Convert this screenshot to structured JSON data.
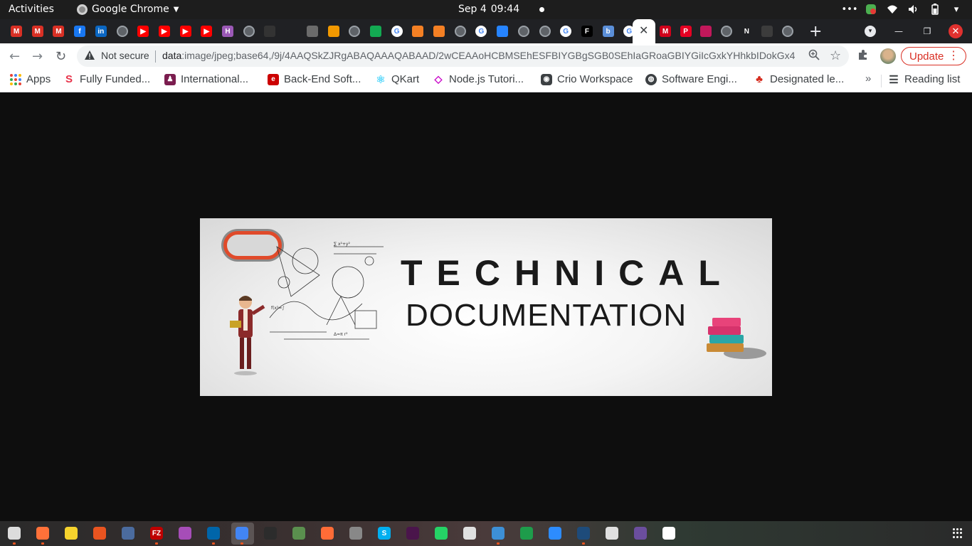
{
  "topbar": {
    "activities": "Activities",
    "app_name": "Google Chrome",
    "date": "Sep 4",
    "time": "09:44"
  },
  "tabs": {
    "favicons": [
      {
        "icon": "gmail-icon",
        "label": "M",
        "color": "#d93025"
      },
      {
        "icon": "gmail-icon",
        "label": "M",
        "color": "#d93025"
      },
      {
        "icon": "gmail-icon",
        "label": "M",
        "color": "#d93025"
      },
      {
        "icon": "facebook-icon",
        "label": "f",
        "color": "#1877f2"
      },
      {
        "icon": "linkedin-icon",
        "label": "in",
        "color": "#0a66c2"
      },
      {
        "icon": "globe-icon",
        "label": "",
        "color": "#5f6368"
      },
      {
        "icon": "youtube-icon",
        "label": "▶",
        "color": "#ff0000"
      },
      {
        "icon": "youtube-icon",
        "label": "▶",
        "color": "#ff0000"
      },
      {
        "icon": "youtube-icon",
        "label": "▶",
        "color": "#ff0000"
      },
      {
        "icon": "youtube-icon",
        "label": "▶",
        "color": "#ff0000"
      },
      {
        "icon": "hackerearth-icon",
        "label": "H",
        "color": "#9b59b6"
      },
      {
        "icon": "globe-icon",
        "label": "",
        "color": "#5f6368"
      },
      {
        "icon": "github-icon",
        "label": "",
        "color": "#333333"
      },
      {
        "icon": "bow-icon",
        "label": "",
        "color": "#202124"
      },
      {
        "icon": "app-icon",
        "label": "",
        "color": "#6b6b6b"
      },
      {
        "icon": "warning-app-icon",
        "label": "",
        "color": "#f29900"
      },
      {
        "icon": "globe-icon",
        "label": "",
        "color": "#5f6368"
      },
      {
        "icon": "mongodb-icon",
        "label": "",
        "color": "#13aa52"
      },
      {
        "icon": "google-icon",
        "label": "G",
        "color": "#ffffff"
      },
      {
        "icon": "stackoverflow-icon",
        "label": "",
        "color": "#f48024"
      },
      {
        "icon": "stackoverflow-icon",
        "label": "",
        "color": "#f48024"
      },
      {
        "icon": "globe-icon",
        "label": "",
        "color": "#5f6368"
      },
      {
        "icon": "google-icon",
        "label": "G",
        "color": "#ffffff"
      },
      {
        "icon": "atlassian-icon",
        "label": "",
        "color": "#2684ff"
      },
      {
        "icon": "globe-icon",
        "label": "",
        "color": "#5f6368"
      },
      {
        "icon": "globe-icon",
        "label": "",
        "color": "#5f6368"
      },
      {
        "icon": "google-icon",
        "label": "G",
        "color": "#ffffff"
      },
      {
        "icon": "f-icon",
        "label": "F",
        "color": "#000000"
      },
      {
        "icon": "bing-icon",
        "label": "b",
        "color": "#5b8fd9"
      },
      {
        "icon": "google-icon",
        "label": "G",
        "color": "#ffffff"
      }
    ],
    "favicons_right": [
      {
        "icon": "m-icon",
        "label": "M",
        "color": "#d0021b"
      },
      {
        "icon": "pinterest-icon",
        "label": "P",
        "color": "#e60023"
      },
      {
        "icon": "app-icon",
        "label": "",
        "color": "#c2185b"
      },
      {
        "icon": "globe-icon",
        "label": "",
        "color": "#5f6368"
      },
      {
        "icon": "notion-icon",
        "label": "N",
        "color": "#202124"
      },
      {
        "icon": "app-icon",
        "label": "",
        "color": "#3c3c3c"
      },
      {
        "icon": "globe-icon",
        "label": "",
        "color": "#5f6368"
      }
    ],
    "new_tab": "+"
  },
  "toolbar": {
    "security_label": "Not secure",
    "url_scheme": "data",
    "url_rest": ":image/jpeg;base64,/9j/4AAQSkZJRgABAQAAAQABAAD/2wCEAAoHCBMSEhESFBIYGBgSGB0SEhIaGRoaGBIYGiIcGxkYHhkbIDokGx4rH...",
    "update_label": "Update"
  },
  "bookmarks": [
    {
      "icon": "apps-icon",
      "label": "Apps"
    },
    {
      "icon": "fully-funded-icon",
      "label": "Fully Funded...",
      "color": "#e8334a"
    },
    {
      "icon": "international-icon",
      "label": "International...",
      "color": "#7b1d4f"
    },
    {
      "icon": "backend-icon",
      "label": "Back-End Soft...",
      "color": "#cc0000"
    },
    {
      "icon": "react-icon",
      "label": "QKart",
      "color": "#61dafb"
    },
    {
      "icon": "code-icon",
      "label": "Node.js Tutori...",
      "color": "#c800c8"
    },
    {
      "icon": "crio-icon",
      "label": "Crio Workspace",
      "color": "#3c4043"
    },
    {
      "icon": "globe-icon",
      "label": "Software Engi...",
      "color": "#3c4043"
    },
    {
      "icon": "maple-leaf-icon",
      "label": "Designated le...",
      "color": "#d52b1e"
    }
  ],
  "bookmarks_more": "»",
  "reading_list": "Reading list",
  "banner": {
    "title_line1": "TECHNICAL",
    "title_line2": "DOCUMENTATION"
  },
  "dock": [
    {
      "icon": "files-icon",
      "label": "",
      "color": "#dcdcdc"
    },
    {
      "icon": "firefox-icon",
      "label": "",
      "color": "#ff7139"
    },
    {
      "icon": "camera-app-icon",
      "label": "",
      "color": "#f6d32d"
    },
    {
      "icon": "software-center-icon",
      "label": "",
      "color": "#e95420"
    },
    {
      "icon": "eclipse-icon",
      "label": "",
      "color": "#4b6b9e"
    },
    {
      "icon": "filezilla-icon",
      "label": "FZ",
      "color": "#bf0000"
    },
    {
      "icon": "video-player-icon",
      "label": "",
      "color": "#a64db8"
    },
    {
      "icon": "vscode-icon",
      "label": "",
      "color": "#0065a9"
    },
    {
      "icon": "chrome-icon",
      "label": "",
      "color": "#4285f4"
    },
    {
      "icon": "terminal-icon",
      "label": "",
      "color": "#2c2c2c"
    },
    {
      "icon": "image-viewer-icon",
      "label": "",
      "color": "#5a8f4e"
    },
    {
      "icon": "postman-icon",
      "label": "",
      "color": "#ff6c37"
    },
    {
      "icon": "app-icon",
      "label": "",
      "color": "#888888"
    },
    {
      "icon": "skype-icon",
      "label": "S",
      "color": "#00aff0"
    },
    {
      "icon": "slack-icon",
      "label": "",
      "color": "#4a154b"
    },
    {
      "icon": "whatsapp-icon",
      "label": "",
      "color": "#25d366"
    },
    {
      "icon": "document-scanner-icon",
      "label": "",
      "color": "#e0e0e0"
    },
    {
      "icon": "text-editor-icon",
      "label": "",
      "color": "#3d8fd6"
    },
    {
      "icon": "spreadsheet-icon",
      "label": "",
      "color": "#1e9c4b"
    },
    {
      "icon": "zoom-icon",
      "label": "",
      "color": "#2d8cff"
    },
    {
      "icon": "mysql-workbench-icon",
      "label": "",
      "color": "#1e4b7a"
    },
    {
      "icon": "book-icon",
      "label": "",
      "color": "#e0e0e0"
    },
    {
      "icon": "screen-recorder-icon",
      "label": "",
      "color": "#6b4e9e"
    },
    {
      "icon": "notes-icon",
      "label": "",
      "color": "#ffffff"
    }
  ]
}
